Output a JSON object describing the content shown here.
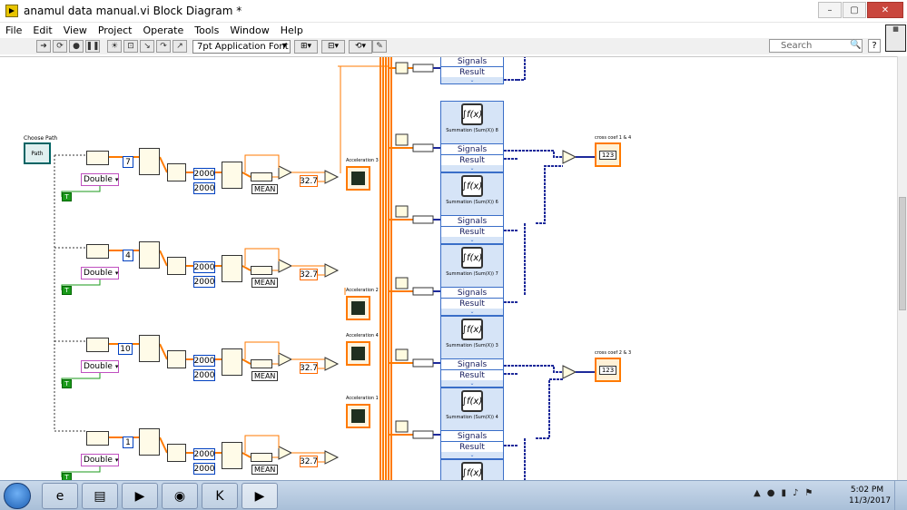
{
  "window": {
    "title": "anamul data manual.vi Block Diagram *",
    "minimize": "–",
    "maximize": "▢",
    "close": "✕"
  },
  "menu": [
    "File",
    "Edit",
    "View",
    "Project",
    "Operate",
    "Tools",
    "Window",
    "Help"
  ],
  "toolbar": {
    "font": "7pt Application Font",
    "search_placeholder": "Search",
    "help": "?"
  },
  "diagram": {
    "path_label": "Choose Path",
    "path_text": "Path",
    "rows": [
      {
        "index": "7",
        "c1": "2000",
        "c2": "2000",
        "mean": "MEAN",
        "scale": "32.7",
        "graph": "Acceleration 3",
        "ring": "Double",
        "bool": "T"
      },
      {
        "index": "4",
        "c1": "2000",
        "c2": "2000",
        "mean": "MEAN",
        "scale": "32.7",
        "graph": "Acceleration 2",
        "ring": "Double",
        "bool": "T"
      },
      {
        "index": "10",
        "c1": "2000",
        "c2": "2000",
        "mean": "MEAN",
        "scale": "32.7",
        "graph": "Acceleration 4",
        "ring": "Double",
        "bool": "T"
      },
      {
        "index": "1",
        "c1": "2000",
        "c2": "2000",
        "mean": "MEAN",
        "scale": "32.7",
        "graph": "Acceleration 1",
        "ring": "Double",
        "bool": "T"
      }
    ],
    "express": {
      "fx": "∫f(x)",
      "signals": "Signals",
      "result": "Result",
      "titles": [
        "Summation (Sum(X)) 4",
        "Summation (Sum(X)) 8",
        "Summation (Sum(X)) 6",
        "Summation (Sum(X)) 7",
        "Summation (Sum(X)) 3",
        "Summation (Sum(X)) 4",
        ""
      ]
    },
    "indicators": [
      {
        "label": "cross coef 1 & 4",
        "value": "123"
      },
      {
        "label": "cross coef 2 & 3",
        "value": "123"
      }
    ]
  },
  "taskbar": {
    "time": "5:02 PM",
    "date": "11/3/2017"
  },
  "colors": {
    "wire_orange": "#ff7a00",
    "wire_blue": "#1e2a9a",
    "wire_green": "#1a9a1a",
    "express_fill": "#d6e4f7"
  }
}
